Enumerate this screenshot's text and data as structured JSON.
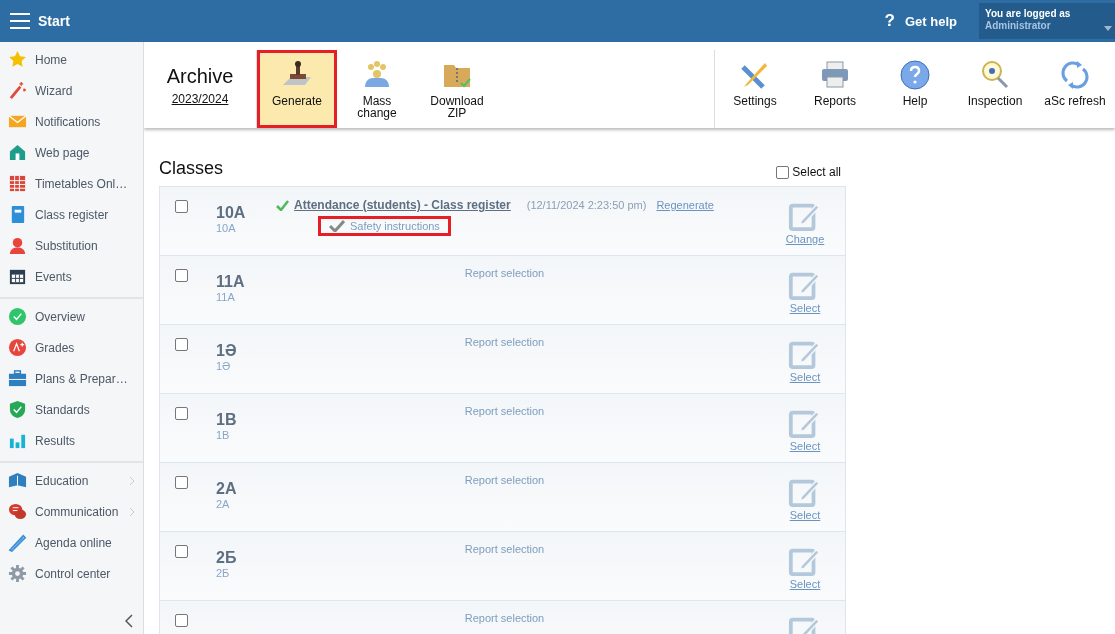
{
  "top_bar": {
    "title": "Start",
    "help": "Get help",
    "help_mark": "?",
    "user": {
      "caption": "You are logged as",
      "name": "Administrator"
    }
  },
  "sidebar": {
    "groups": [
      [
        {
          "label": "Home"
        },
        {
          "label": "Wizard"
        },
        {
          "label": "Notifications"
        },
        {
          "label": "Web page"
        },
        {
          "label": "Timetables Onl…"
        },
        {
          "label": "Class register"
        },
        {
          "label": "Substitution"
        },
        {
          "label": "Events"
        }
      ],
      [
        {
          "label": "Overview"
        },
        {
          "label": "Grades"
        },
        {
          "label": "Plans & Prepar…"
        },
        {
          "label": "Standards"
        },
        {
          "label": "Results"
        }
      ],
      [
        {
          "label": "Education",
          "has_submenu": true
        },
        {
          "label": "Communication",
          "has_submenu": true
        },
        {
          "label": "Agenda online",
          "has_submenu": false
        },
        {
          "label": "Control center",
          "has_submenu": false
        }
      ]
    ]
  },
  "toolbar": {
    "title": "Archive",
    "year": "2023/2024",
    "left_buttons": [
      {
        "label": "Generate",
        "highlighted": true
      },
      {
        "label": "Mass change",
        "highlighted": false
      },
      {
        "label": "Download ZIP",
        "highlighted": false
      }
    ],
    "right_buttons": [
      {
        "label": "Settings"
      },
      {
        "label": "Reports"
      },
      {
        "label": "Help"
      },
      {
        "label": "Inspection"
      },
      {
        "label": "aSc refresh"
      }
    ]
  },
  "classes": {
    "title": "Classes",
    "select_all": {
      "label": "Select all",
      "checked": false
    },
    "rows": [
      {
        "name": "10A",
        "code": "10A",
        "checked": false,
        "reports": [
          {
            "title": "Attendance (students) - Class register",
            "timestamp": "(12/11/2024 2:23:50 pm)",
            "action": "Regenerate",
            "done": true,
            "sub_items": [
              {
                "label": "Safety instructions",
                "highlighted": true
              }
            ]
          }
        ],
        "edit_label": "Change"
      },
      {
        "name": "11A",
        "code": "11A",
        "checked": false,
        "empty_label": "Report selection",
        "edit_label": "Select"
      },
      {
        "name": "1Ə",
        "code": "1Ə",
        "checked": false,
        "empty_label": "Report selection",
        "edit_label": "Select"
      },
      {
        "name": "1B",
        "code": "1B",
        "checked": false,
        "empty_label": "Report selection",
        "edit_label": "Select"
      },
      {
        "name": "2A",
        "code": "2A",
        "checked": false,
        "empty_label": "Report selection",
        "edit_label": "Select"
      },
      {
        "name": "2Б",
        "code": "2Б",
        "checked": false,
        "empty_label": "Report selection",
        "edit_label": "Select"
      },
      {
        "checked": false,
        "empty_label": "Report selection"
      }
    ]
  }
}
